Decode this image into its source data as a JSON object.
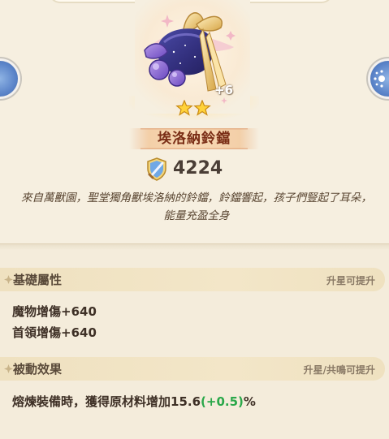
{
  "item": {
    "name": "埃洛納鈴鐺",
    "level_bonus": "+6",
    "stars": 2,
    "power": "4224",
    "description": "來自萬獸園，聖堂獨角獸埃洛納的鈴鐺，鈴鐺響起，孩子們豎起了耳朵，能量充盈全身"
  },
  "base_attributes": {
    "title": "基礎屬性",
    "hint": "升星可提升",
    "lines": [
      "魔物增傷+640",
      "首領增傷+640"
    ]
  },
  "passive": {
    "title": "被動效果",
    "hint": "升星/共鳴可提升",
    "line_prefix": "熔煉裝備時，獲得原材料增加15.6",
    "line_bonus": "(+0.5)",
    "line_suffix": "%"
  },
  "icons": [
    "bell-item-icon",
    "star-icon",
    "sword-shield-power-icon",
    "section-bullet-icon",
    "nav-left-icon",
    "nav-right-icon"
  ],
  "colors": {
    "background": "#f4ecdb",
    "item_name": "#7a2e16",
    "bonus_green": "#2aa84a",
    "section_header": "#efe1c0"
  }
}
